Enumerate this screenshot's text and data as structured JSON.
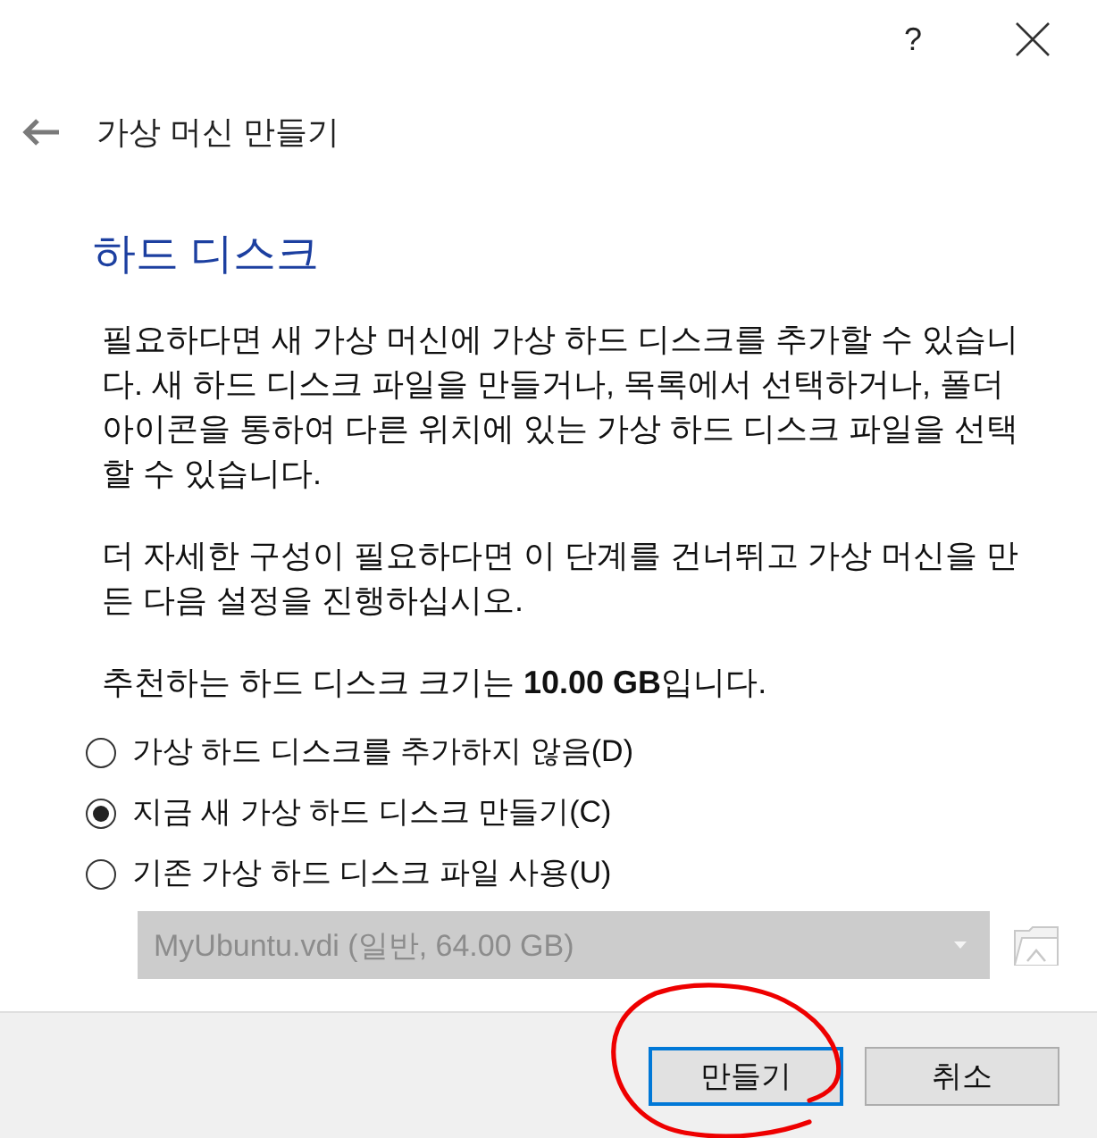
{
  "title_bar": {
    "help": "?"
  },
  "header": {
    "title": "가상 머신 만들기"
  },
  "page": {
    "heading": "하드 디스크",
    "paragraphs": [
      "필요하다면 새 가상 머신에 가상 하드 디스크를 추가할 수 있습니다. 새 하드 디스크 파일을 만들거나, 목록에서 선택하거나, 폴더 아이콘을 통하여 다른 위치에 있는 가상 하드 디스크 파일을 선택할 수 있습니다.",
      "더 자세한 구성이 필요하다면 이 단계를 건너뛰고 가상 머신을 만든 다음 설정을 진행하십시오.",
      "추천하는 하드 디스크 크기는 **10.00 GB**입니다."
    ]
  },
  "options": [
    {
      "label": "가상 하드 디스크를 추가하지 않음(D)",
      "selected": false
    },
    {
      "label": "지금 새 가상 하드 디스크 만들기(C)",
      "selected": true
    },
    {
      "label": "기존 가상 하드 디스크 파일 사용(U)",
      "selected": false
    }
  ],
  "disk_select": {
    "value": "MyUbuntu.vdi (일반, 64.00 GB)",
    "disabled": true
  },
  "buttons": [
    {
      "label": "만들기",
      "focused": true,
      "circled": true
    },
    {
      "label": "취소",
      "focused": false,
      "circled": false
    }
  ]
}
